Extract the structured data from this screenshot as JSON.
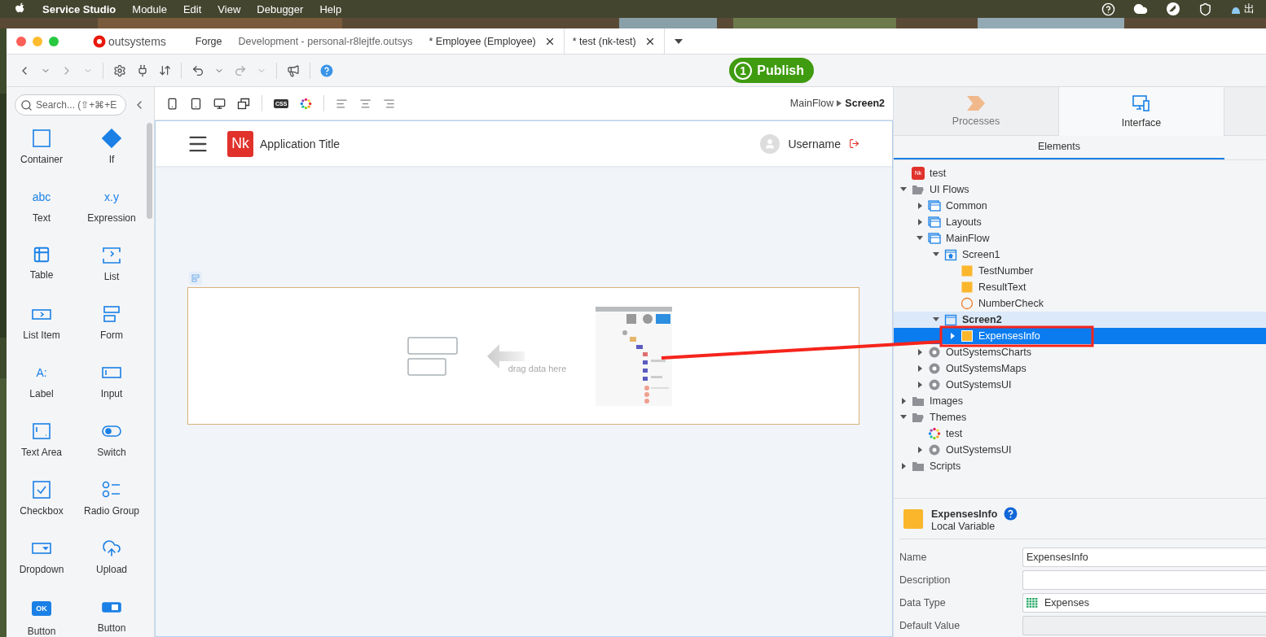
{
  "menu_bar": {
    "app_name": "Service Studio",
    "menus": [
      "Module",
      "Edit",
      "View",
      "Debugger",
      "Help"
    ],
    "status_text": "出"
  },
  "window": {
    "logo": "outsystems",
    "tabs": [
      {
        "label": "Forge",
        "selected": false,
        "closable": false,
        "faded": false
      },
      {
        "label": "Development - personal-r8lejtfe.outsys",
        "selected": false,
        "closable": false,
        "faded": true
      },
      {
        "label": "* Employee (Employee)",
        "selected": false,
        "closable": true,
        "faded": false
      },
      {
        "label": "* test (nk-test)",
        "selected": true,
        "closable": true,
        "faded": false
      }
    ]
  },
  "toolbar": {
    "publish": {
      "count": "1",
      "label": "Publish"
    }
  },
  "palette": {
    "search": {
      "placeholder": "Search... (⇧+⌘+E"
    },
    "items": [
      {
        "label": "Container",
        "kind": "square"
      },
      {
        "label": "If",
        "kind": "diamond"
      },
      {
        "label": "Text",
        "kind": "glyph",
        "glyph": "abc"
      },
      {
        "label": "Expression",
        "kind": "glyph",
        "glyph": "x.y"
      },
      {
        "label": "Table",
        "kind": "table"
      },
      {
        "label": "List",
        "kind": "list"
      },
      {
        "label": "List Item",
        "kind": "listitem"
      },
      {
        "label": "Form",
        "kind": "form"
      },
      {
        "label": "Label",
        "kind": "glyph",
        "glyph": "A:"
      },
      {
        "label": "Input",
        "kind": "input"
      },
      {
        "label": "Text Area",
        "kind": "textarea"
      },
      {
        "label": "Switch",
        "kind": "switch"
      },
      {
        "label": "Checkbox",
        "kind": "checkbox"
      },
      {
        "label": "Radio Group",
        "kind": "radio"
      },
      {
        "label": "Dropdown",
        "kind": "dropdown"
      },
      {
        "label": "Upload",
        "kind": "upload"
      },
      {
        "label": "Button",
        "kind": "pill",
        "glyph": "OK"
      },
      {
        "label": "Button",
        "kind": "buttongroup"
      }
    ]
  },
  "canvas": {
    "toolbar": {
      "css_glyph": "CSS"
    },
    "breadcrumb": {
      "parent": "MainFlow",
      "current": "Screen2"
    },
    "app_header": {
      "logo": "Nk",
      "title": "Application Title",
      "username": "Username"
    },
    "placeholder": {
      "hint": "drag data here"
    }
  },
  "right_panel": {
    "tabs": [
      {
        "label": "Processes",
        "selected": false
      },
      {
        "label": "Interface",
        "selected": true
      }
    ],
    "subtab": "Elements",
    "tree": [
      {
        "label": "test",
        "kind": "app",
        "badge": "Nk"
      },
      {
        "label": "UI Flows",
        "kind": "openfolder",
        "expanded": true,
        "children": [
          {
            "label": "Common",
            "kind": "flow",
            "expanded": false
          },
          {
            "label": "Layouts",
            "kind": "flow",
            "expanded": false
          },
          {
            "label": "MainFlow",
            "kind": "flow",
            "expanded": true,
            "children": [
              {
                "label": "Screen1",
                "kind": "homescreen",
                "expanded": true,
                "children": [
                  {
                    "label": "TestNumber",
                    "kind": "variable"
                  },
                  {
                    "label": "ResultText",
                    "kind": "variable"
                  },
                  {
                    "label": "NumberCheck",
                    "kind": "action"
                  }
                ]
              },
              {
                "label": "Screen2",
                "kind": "screen",
                "expanded": true,
                "highlighted": true,
                "children": [
                  {
                    "label": "ExpensesInfo",
                    "kind": "variable",
                    "expanded": false,
                    "selected": true
                  }
                ]
              }
            ]
          },
          {
            "label": "OutSystemsCharts",
            "kind": "module",
            "expanded": false
          },
          {
            "label": "OutSystemsMaps",
            "kind": "module",
            "expanded": false
          },
          {
            "label": "OutSystemsUI",
            "kind": "module",
            "expanded": false
          }
        ]
      },
      {
        "label": "Images",
        "kind": "folder",
        "expanded": false
      },
      {
        "label": "Themes",
        "kind": "openfolder",
        "expanded": true,
        "children": [
          {
            "label": "test",
            "kind": "theme"
          },
          {
            "label": "OutSystemsUI",
            "kind": "module",
            "expanded": false
          }
        ]
      },
      {
        "label": "Scripts",
        "kind": "folder",
        "expanded": false
      }
    ],
    "properties": {
      "title": "ExpensesInfo",
      "subtitle": "Local Variable",
      "fields": [
        {
          "label": "Name",
          "value": "ExpensesInfo",
          "kind": "text"
        },
        {
          "label": "Description",
          "kind": "text"
        },
        {
          "label": "Data Type",
          "value": "Expenses",
          "kind": "type"
        },
        {
          "label": "Default Value",
          "kind": "disabled"
        }
      ]
    }
  }
}
